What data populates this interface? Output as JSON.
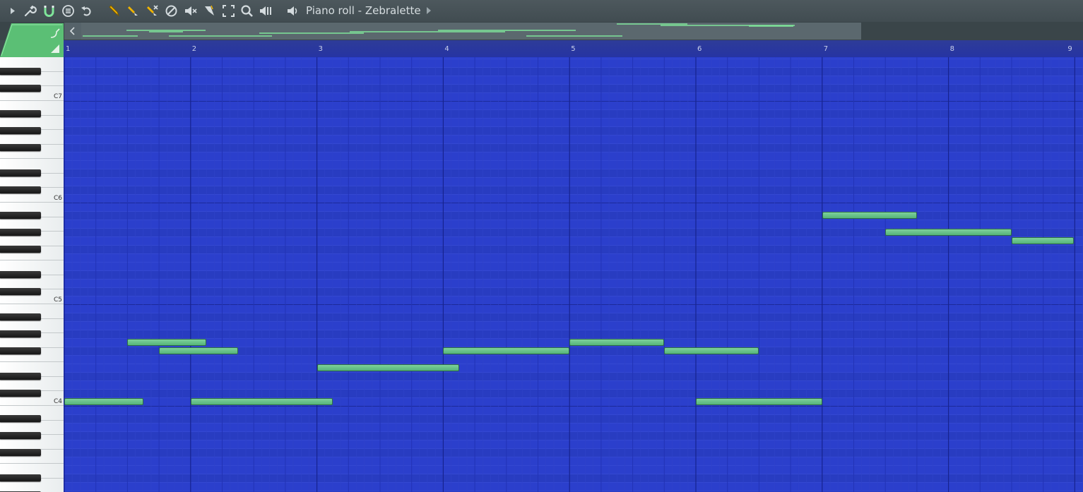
{
  "window": {
    "title": "Piano roll - Zebralette"
  },
  "toolbar": {
    "icons": [
      "play-arrow-icon",
      "wrench-icon",
      "magnet-icon",
      "menu-circle-icon",
      "undo-icon",
      "pencil-icon",
      "paint-brush-icon",
      "delete-brush-icon",
      "mute-circle-icon",
      "speaker-mute-icon",
      "slice-icon",
      "select-icon",
      "zoom-icon",
      "playback-icon",
      "speaker-icon"
    ]
  },
  "ruler": {
    "bars": [
      "1",
      "2",
      "3",
      "4",
      "5",
      "6",
      "7",
      "8",
      "9"
    ]
  },
  "keyboard": {
    "labels": [
      "C7",
      "C6",
      "C5",
      "C4"
    ]
  },
  "notes": [
    {
      "pitch": "C4",
      "start_bar": 1.0,
      "length_bars": 0.625
    },
    {
      "pitch": "G4",
      "start_bar": 1.5,
      "length_bars": 0.625
    },
    {
      "pitch": "F#4",
      "start_bar": 1.75,
      "length_bars": 0.625
    },
    {
      "pitch": "C4",
      "start_bar": 2.0,
      "length_bars": 1.125
    },
    {
      "pitch": "E4",
      "start_bar": 3.0,
      "length_bars": 1.125
    },
    {
      "pitch": "F#4",
      "start_bar": 4.0,
      "length_bars": 1.0
    },
    {
      "pitch": "G4",
      "start_bar": 5.0,
      "length_bars": 0.75
    },
    {
      "pitch": "F#4",
      "start_bar": 5.75,
      "length_bars": 0.75
    },
    {
      "pitch": "C4",
      "start_bar": 6.0,
      "length_bars": 1.0
    },
    {
      "pitch": "A#5",
      "start_bar": 7.0,
      "length_bars": 0.75
    },
    {
      "pitch": "G#5",
      "start_bar": 7.5,
      "length_bars": 1.0
    },
    {
      "pitch": "G5",
      "start_bar": 8.5,
      "length_bars": 0.5
    }
  ],
  "colors": {
    "grid_background": "#2b3fcc",
    "note_fill": "#6cc38c",
    "ruler": "#2a38a0",
    "toolbar_accent": "#f0b400",
    "overview_accent": "#7fe59a"
  }
}
